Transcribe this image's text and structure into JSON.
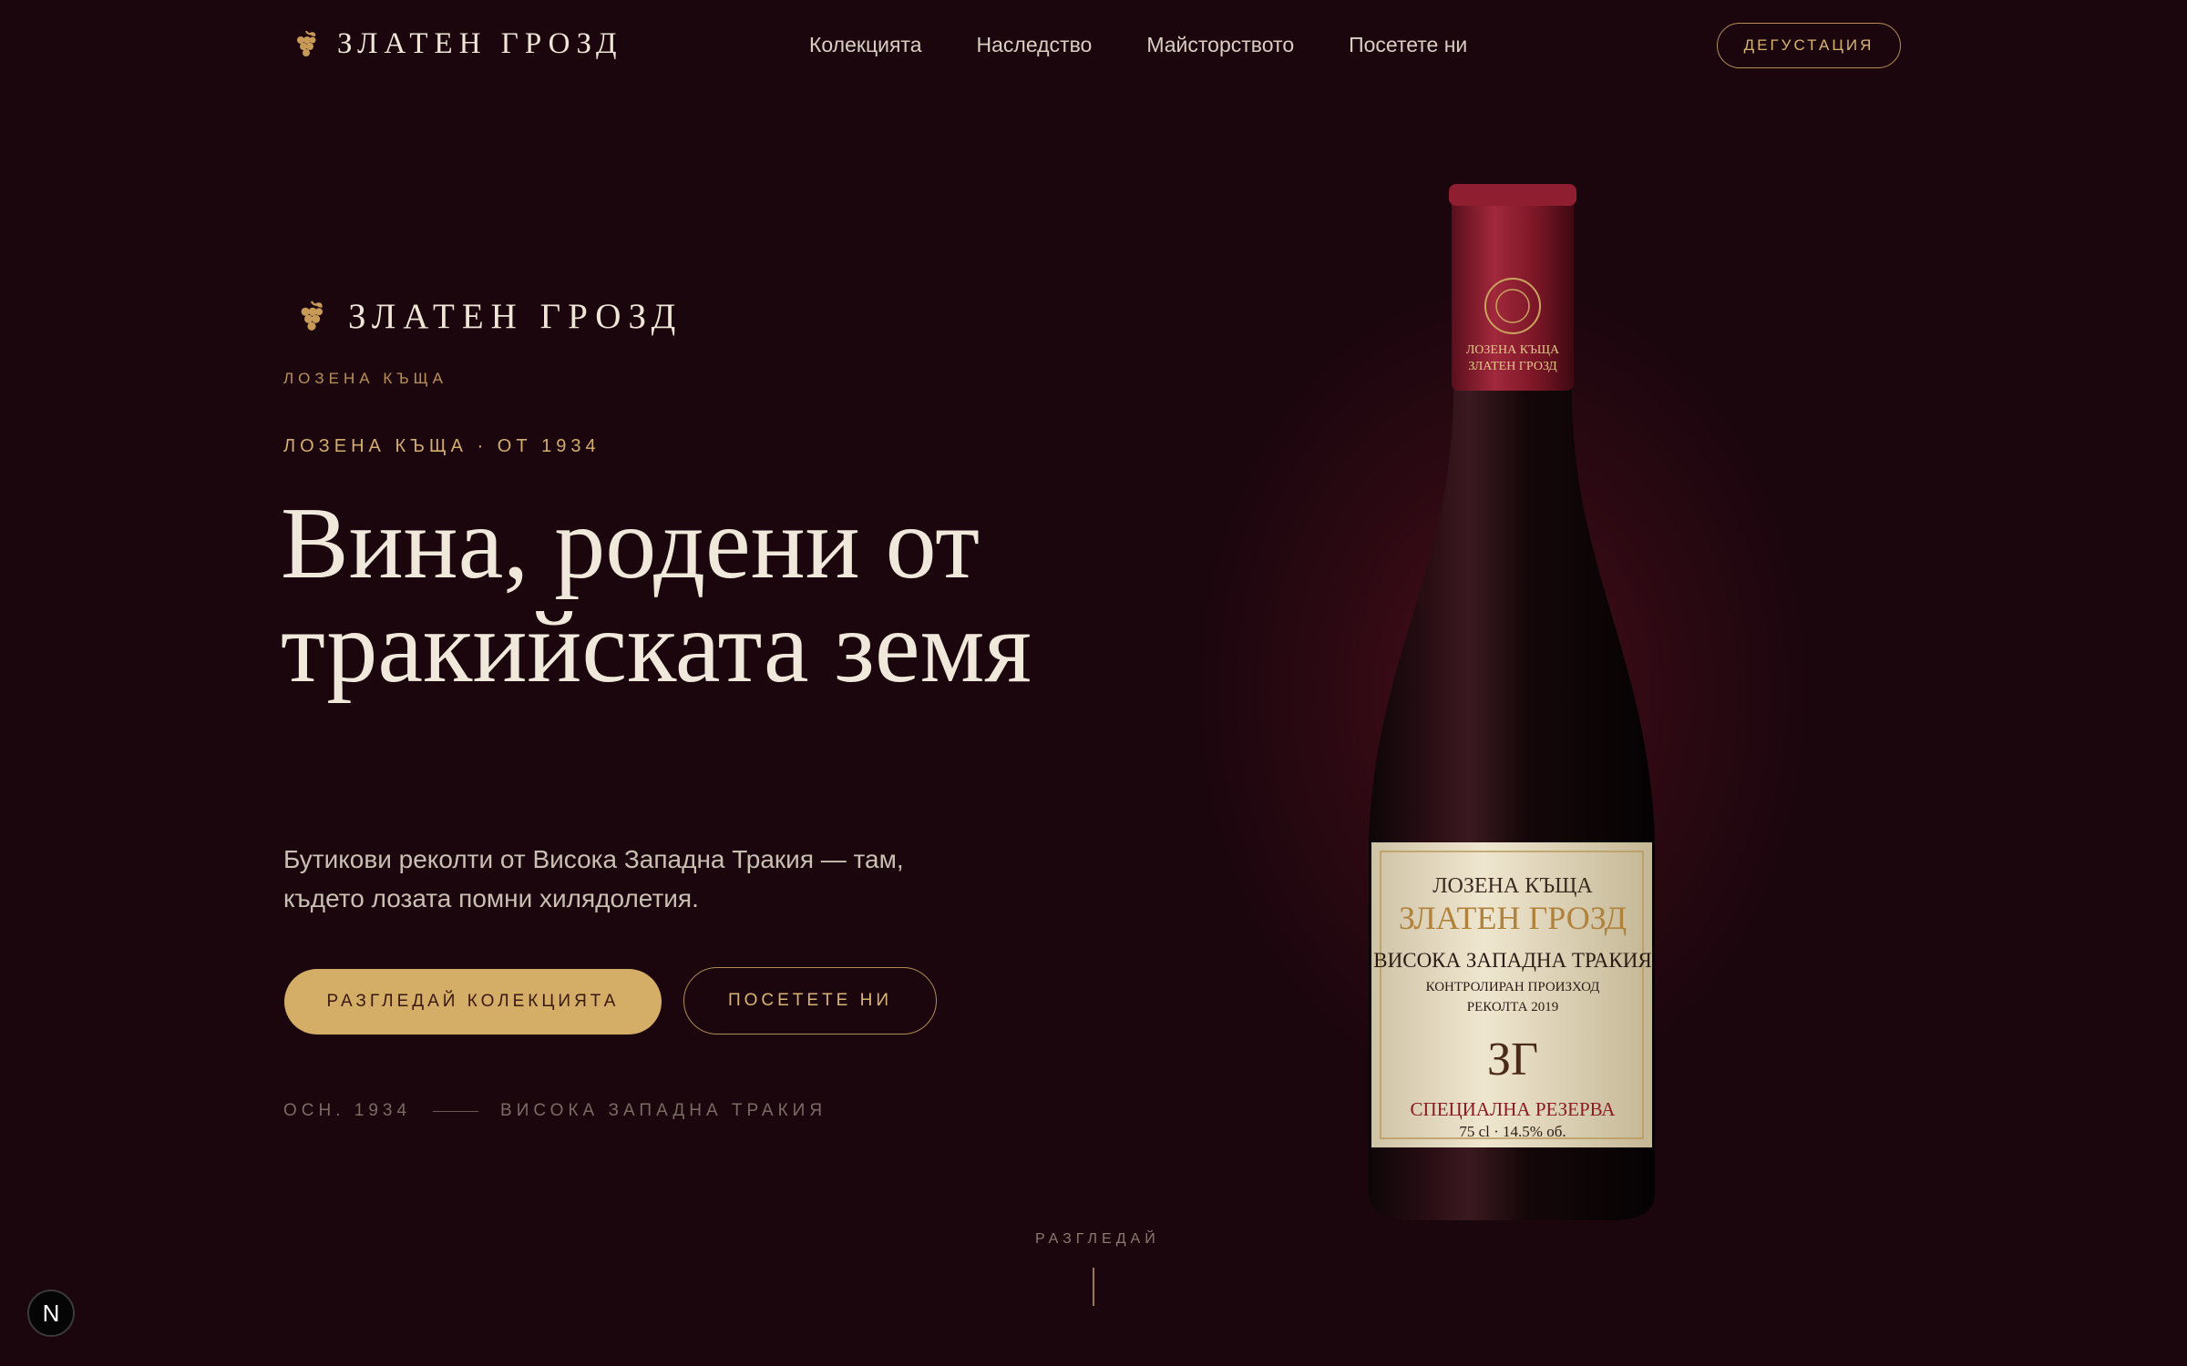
{
  "nav": {
    "logo_text": "ЗЛАТЕН ГРОЗД",
    "links": [
      "Колекцията",
      "Наследство",
      "Майсторството",
      "Посетете ни"
    ],
    "cta": "ДЕГУСТАЦИЯ"
  },
  "hero": {
    "brand_text": "ЗЛАТЕН ГРОЗД",
    "brand_sub": "ЛОЗЕНА КЪЩА",
    "eyebrow": "ЛОЗЕНА КЪЩА · ОТ 1934",
    "headline": "Вина, родени от тракийската земя",
    "description": "Бутикови реколти от Висока Западна Тракия — там, където лозата помни хилядолетия.",
    "primary_button": "РАЗГЛЕДАЙ КОЛЕКЦИЯТА",
    "secondary_button": "ПОСЕТЕТЕ НИ",
    "meta_left": "ОСН. 1934",
    "meta_right": "ВИСОКА ЗАПАДНА ТРАКИЯ"
  },
  "bottle_label": {
    "capsule_line1": "ЛОЗЕНА КЪЩА",
    "capsule_line2": "ЗЛАТЕН ГРОЗД",
    "house": "ЛОЗЕНА КЪЩА",
    "brand": "ЗЛАТЕН ГРОЗД",
    "region": "ВИСОКА ЗАПАДНА ТРАКИЯ",
    "designation": "КОНТРОЛИРАН ПРОИЗХОД",
    "vintage": "РЕКОЛТА 2019",
    "monogram": "ЗГ",
    "reserve": "СПЕЦИАЛНА РЕЗЕРВА",
    "volume": "75 cl · 14.5% об."
  },
  "scroll": {
    "label": "РАЗГЛЕДАЙ"
  },
  "badge": {
    "label": "N"
  },
  "colors": {
    "background": "#1c060e",
    "accent_gold": "#d4ae66",
    "text_light": "#efe6d8",
    "wine_red": "#8a1a2c"
  },
  "icons": [
    "grape-icon"
  ]
}
